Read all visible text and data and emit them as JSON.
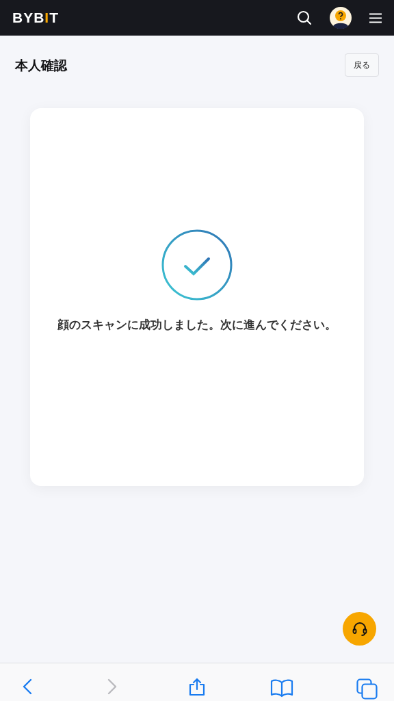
{
  "header": {
    "logo_parts": [
      {
        "text": "BYB",
        "accent": false
      },
      {
        "text": "I",
        "accent": true
      },
      {
        "text": "T",
        "accent": false
      }
    ]
  },
  "page": {
    "title": "本人確認",
    "back_button": "戻る"
  },
  "result": {
    "kind": "success",
    "message": "顔のスキャンに成功しました。次に進んでください。"
  },
  "browser_toolbar": [
    {
      "kind": "back",
      "disabled": false
    },
    {
      "kind": "forward",
      "disabled": true
    },
    {
      "kind": "share",
      "disabled": false
    },
    {
      "kind": "bookmarks",
      "disabled": false
    },
    {
      "kind": "tabs",
      "disabled": false
    }
  ]
}
